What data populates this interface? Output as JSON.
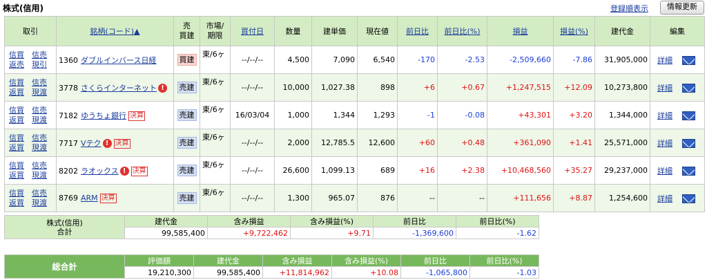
{
  "header": {
    "title": "株式(信用)",
    "sort_link": "登録順表示",
    "refresh_button": "情報更新"
  },
  "table": {
    "columns": {
      "trade": "取引",
      "name": "銘柄(コード)▲",
      "bs": "売\n買建",
      "market": "市場/\n期限",
      "buy_date": "買付日",
      "qty": "数量",
      "cost": "建単価",
      "price": "現在値",
      "change": "前日比",
      "change_pct": "前日比(%)",
      "pl": "損益",
      "pl_pct": "損益(%)",
      "amount": "建代金",
      "edit": "編集"
    },
    "rows": [
      {
        "trade": [
          "信買",
          "信売",
          "返売",
          "現引"
        ],
        "code": "1360",
        "name": "ダブルインバース日経",
        "warn": false,
        "kessan": false,
        "bs": "買建",
        "bs_type": "buy",
        "market": "東/6ヶ",
        "buy_date": "--/--/--",
        "qty": "4,500",
        "cost": "7,090",
        "price": "6,540",
        "change": "-170",
        "change_pct": "-2.53",
        "pl": "-2,509,660",
        "pl_pct": "-7.86",
        "amount": "31,905,000",
        "detail": "詳細"
      },
      {
        "trade": [
          "信買",
          "信売",
          "返買",
          "現渡"
        ],
        "code": "3778",
        "name": "さくらインターネット",
        "warn": true,
        "kessan": false,
        "bs": "売建",
        "bs_type": "sell",
        "market": "東/6ヶ",
        "buy_date": "--/--/--",
        "qty": "10,000",
        "cost": "1,027.38",
        "price": "898",
        "change": "+6",
        "change_pct": "+0.67",
        "pl": "+1,247,515",
        "pl_pct": "+12.09",
        "amount": "10,273,800",
        "detail": "詳細"
      },
      {
        "trade": [
          "信買",
          "信売",
          "返買",
          "現渡"
        ],
        "code": "7182",
        "name": "ゆうちょ銀行",
        "warn": false,
        "kessan": true,
        "bs": "売建",
        "bs_type": "sell",
        "market": "東/6ヶ",
        "buy_date": "16/03/04",
        "qty": "1,000",
        "cost": "1,344",
        "price": "1,293",
        "change": "-1",
        "change_pct": "-0.08",
        "pl": "+43,301",
        "pl_pct": "+3.20",
        "amount": "1,344,000",
        "detail": "詳細"
      },
      {
        "trade": [
          "信買",
          "信売",
          "返買",
          "現渡"
        ],
        "code": "7717",
        "name": "Vテク",
        "warn": true,
        "kessan": true,
        "bs": "売建",
        "bs_type": "sell",
        "market": "東/6ヶ",
        "buy_date": "--/--/--",
        "qty": "2,000",
        "cost": "12,785.5",
        "price": "12,600",
        "change": "+60",
        "change_pct": "+0.48",
        "pl": "+361,090",
        "pl_pct": "+1.41",
        "amount": "25,571,000",
        "detail": "詳細"
      },
      {
        "trade": [
          "信買",
          "信売",
          "返買",
          "現渡"
        ],
        "code": "8202",
        "name": "ラオックス",
        "warn": true,
        "kessan": true,
        "bs": "売建",
        "bs_type": "sell",
        "market": "東/6ヶ",
        "buy_date": "--/--/--",
        "qty": "26,600",
        "cost": "1,099.13",
        "price": "689",
        "change": "+16",
        "change_pct": "+2.38",
        "pl": "+10,468,560",
        "pl_pct": "+35.27",
        "amount": "29,237,000",
        "detail": "詳細"
      },
      {
        "trade": [
          "信買",
          "信売",
          "返買",
          "現渡"
        ],
        "code": "8769",
        "name": "ARM",
        "warn": false,
        "kessan": true,
        "bs": "売建",
        "bs_type": "sell",
        "market": "東/6ヶ",
        "buy_date": "--/--/--",
        "qty": "1,300",
        "cost": "965.07",
        "price": "876",
        "change": "--",
        "change_pct": "--",
        "pl": "+111,656",
        "pl_pct": "+8.87",
        "amount": "1,254,600",
        "detail": "詳細"
      }
    ],
    "kessan_label": "決算",
    "warn_label": "!"
  },
  "subtotal": {
    "label_line1": "株式(信用)",
    "label_line2": "合計",
    "headers": [
      "建代金",
      "含み損益",
      "含み損益(%)",
      "前日比",
      "前日比(%)"
    ],
    "values": [
      "99,585,400",
      "+9,722,462",
      "+9.71",
      "-1,369,600",
      "-1.62"
    ]
  },
  "grand_total": {
    "label": "総合計",
    "headers": [
      "評価額",
      "建代金",
      "含み損益",
      "含み損益(%)",
      "前日比",
      "前日比(%)"
    ],
    "values": [
      "19,210,300",
      "99,585,400",
      "+11,814,962",
      "+10.08",
      "-1,065,800",
      "-1.03"
    ]
  },
  "colors": {
    "header_bg": "#d4ecc4",
    "grand_header_bg": "#78b85c",
    "positive": "#e01010",
    "negative": "#1a3cd8",
    "link": "#1a3c9c"
  }
}
